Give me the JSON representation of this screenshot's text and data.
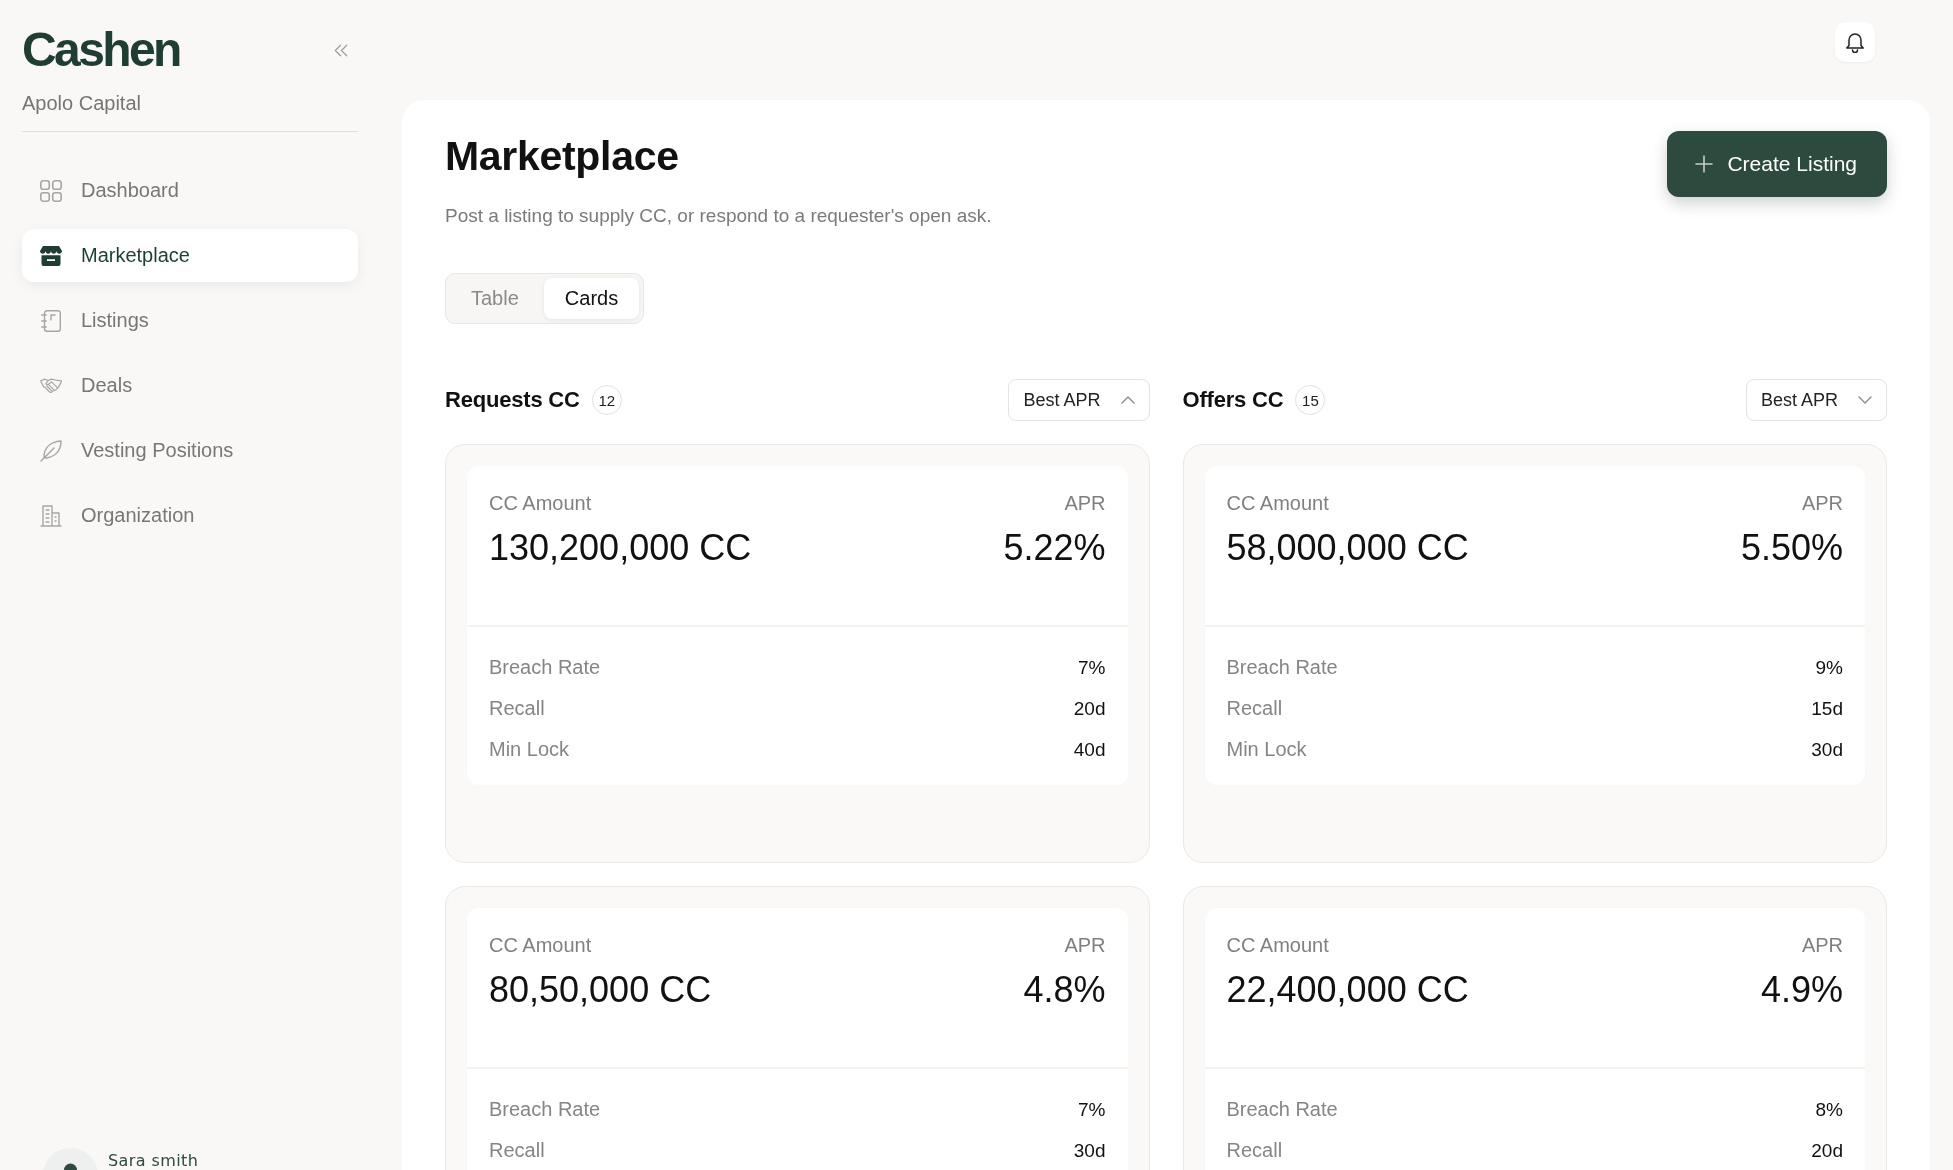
{
  "sidebar": {
    "logo": "Cashen",
    "organization": "Apolo Capital",
    "nav": [
      {
        "label": "Dashboard",
        "selected": false
      },
      {
        "label": "Marketplace",
        "selected": true
      },
      {
        "label": "Listings",
        "selected": false
      },
      {
        "label": "Deals",
        "selected": false
      },
      {
        "label": "Vesting Positions",
        "selected": false
      },
      {
        "label": "Organization",
        "selected": false
      }
    ],
    "user": {
      "name": "Sara smith"
    }
  },
  "page": {
    "title": "Marketplace",
    "subtitle": "Post a listing to supply CC, or respond to a requester's open ask.",
    "create_button": "Create Listing",
    "view_toggle": [
      {
        "label": "Table",
        "selected": false
      },
      {
        "label": "Cards",
        "selected": true
      }
    ]
  },
  "columns": [
    {
      "title": "Requests CC",
      "count": "12",
      "sort": {
        "label": "Best APR",
        "ascending": true
      },
      "cards": [
        {
          "amount_label": "CC Amount",
          "amount": "130,200,000 CC",
          "apr_label": "APR",
          "apr": "5.22%",
          "terms": [
            {
              "label": "Breach Rate",
              "value": "7%"
            },
            {
              "label": "Recall",
              "value": "20d"
            },
            {
              "label": "Min Lock",
              "value": "40d"
            }
          ]
        },
        {
          "amount_label": "CC Amount",
          "amount": "80,50,000 CC",
          "apr_label": "APR",
          "apr": "4.8%",
          "terms": [
            {
              "label": "Breach Rate",
              "value": "7%"
            },
            {
              "label": "Recall",
              "value": "30d"
            }
          ]
        }
      ]
    },
    {
      "title": "Offers CC",
      "count": "15",
      "sort": {
        "label": "Best APR",
        "ascending": false
      },
      "cards": [
        {
          "amount_label": "CC Amount",
          "amount": "58,000,000 CC",
          "apr_label": "APR",
          "apr": "5.50%",
          "terms": [
            {
              "label": "Breach Rate",
              "value": "9%"
            },
            {
              "label": "Recall",
              "value": "15d"
            },
            {
              "label": "Min Lock",
              "value": "30d"
            }
          ]
        },
        {
          "amount_label": "CC Amount",
          "amount": "22,400,000 CC",
          "apr_label": "APR",
          "apr": "4.9%",
          "terms": [
            {
              "label": "Breach Rate",
              "value": "8%"
            },
            {
              "label": "Recall",
              "value": "20d"
            }
          ]
        }
      ]
    }
  ]
}
